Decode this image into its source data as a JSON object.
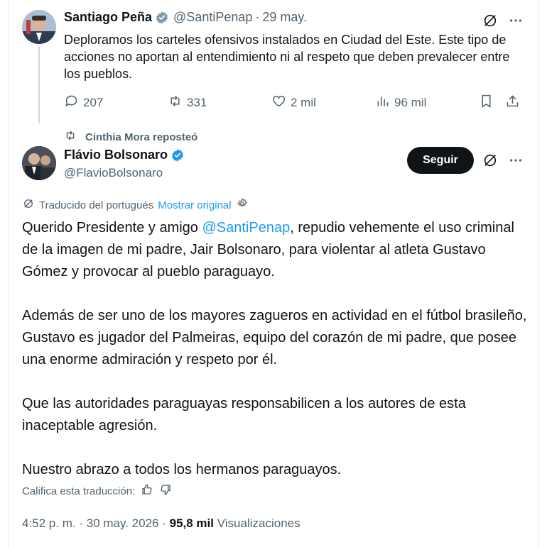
{
  "tweet1": {
    "author_name": "Santiago Peña",
    "handle": "@SantiPenap",
    "date": "29 may.",
    "text": "Deploramos los carteles ofensivos instalados en Ciudad del Este. Este tipo de acciones no aportan al entendimiento ni al respeto que deben prevalecer entre los pueblos.",
    "replies": "207",
    "reposts": "331",
    "likes": "2 mil",
    "views": "96 mil"
  },
  "repost": {
    "label": "Cinthia Mora reposteó"
  },
  "tweet2": {
    "author_name": "Flávio Bolsonaro",
    "handle": "@FlavioBolsonaro",
    "follow_label": "Seguir",
    "translated_label": "Traducido del portugués",
    "show_original": "Mostrar original",
    "p1_before": "Querido Presidente y amigo ",
    "p1_mention": "@SantiPenap",
    "p1_after": ", repudio vehemente el uso criminal de la imagen de mi padre, Jair Bolsonaro, para violentar al atleta Gustavo Gómez y provocar al pueblo paraguayo.",
    "p2": "Además de ser uno de los mayores zagueros en actividad en el fútbol brasileño, Gustavo es jugador del Palmeiras, equipo del corazón de mi padre, que posee una enorme admiración y respeto por él.",
    "p3": "Que las autoridades paraguayas responsabilicen a los autores de esta inaceptable agresión.",
    "p4": "Nuestro abrazo a todos los hermanos paraguayos.",
    "rate_label": "Califica esta traducción:",
    "time": "4:52 p. m.",
    "date": "30 may. 2026",
    "views_count": "95,8 mil",
    "views_label": "Visualizaciones"
  },
  "colors": {
    "accent": "#1d9bf0",
    "text": "#0f1419",
    "muted": "#536471",
    "button": "#0f1419"
  },
  "icons": [
    "verified-badge-icon",
    "grok-icon",
    "more-icon",
    "reply-icon",
    "repost-icon",
    "like-icon",
    "views-icon",
    "bookmark-icon",
    "share-icon",
    "settings-icon",
    "thumbs-up-icon",
    "thumbs-down-icon"
  ]
}
